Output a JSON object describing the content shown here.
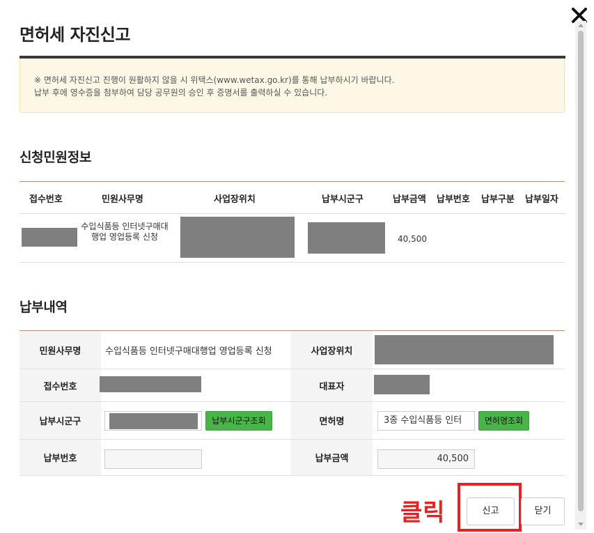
{
  "modal": {
    "title": "면허세 자진신고",
    "notice_line1": "※ 면허세 자진신고 진행이 원활하지 않을 시 위택스(www.wetax.go.kr)를 통해 납부하시기 바랍니다.",
    "notice_line2": "납부 후에 영수증을 첨부하여 담당 공무원의 승인 후 증명서를 출력하실 수 있습니다."
  },
  "applicant_section": {
    "title": "신청민원정보",
    "columns": [
      "접수번호",
      "민원사무명",
      "사업장위치",
      "납부시군구",
      "납부금액",
      "납부번호",
      "납부구분",
      "납부일자"
    ],
    "row": {
      "service_name": "수입식품등 인터넷구매대행업 영업등록 신청",
      "amount": "40,500"
    }
  },
  "payment_section": {
    "title": "납부내역",
    "labels": {
      "service_name": "민원사무명",
      "business_location": "사업장위치",
      "receipt_no": "접수번호",
      "representative": "대표자",
      "district": "납부시군구",
      "license_name": "면허명",
      "payment_no": "납부번호",
      "payment_amount": "납부금액"
    },
    "values": {
      "service_name": "수입식품등 인터넷구매대행업 영업등록 신청",
      "license_name": "3종 수입식품등 인터",
      "payment_amount": "40,500"
    },
    "buttons": {
      "district_lookup": "납부시군구조회",
      "license_lookup": "면허명조회"
    }
  },
  "footer": {
    "annotation": "클릭",
    "report_button": "신고",
    "close_button": "닫기"
  },
  "colors": {
    "accent_green": "#48b548",
    "annotation_red": "#e52222",
    "notice_bg": "#fdf7e6"
  }
}
